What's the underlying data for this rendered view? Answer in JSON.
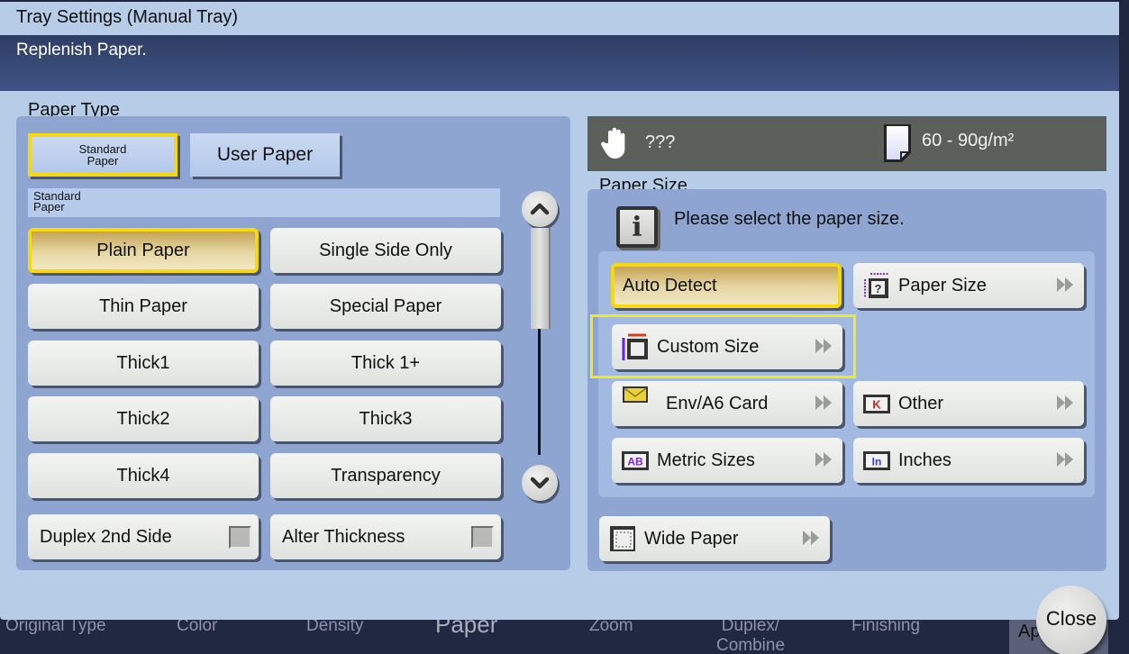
{
  "dialog": {
    "title": "Tray Settings (Manual Tray)",
    "message": "Replenish Paper."
  },
  "paper_type": {
    "label": "Paper Type",
    "tabs": [
      {
        "label": "Standard\nPaper",
        "selected": true
      },
      {
        "label": "User Paper",
        "selected": false
      }
    ],
    "category_label": "Standard\nPaper",
    "options": [
      {
        "label": "Plain Paper",
        "selected": true
      },
      {
        "label": "Single Side Only",
        "selected": false
      },
      {
        "label": "Thin Paper",
        "selected": false
      },
      {
        "label": "Special Paper",
        "selected": false
      },
      {
        "label": "Thick1",
        "selected": false
      },
      {
        "label": "Thick 1+",
        "selected": false
      },
      {
        "label": "Thick2",
        "selected": false
      },
      {
        "label": "Thick3",
        "selected": false
      },
      {
        "label": "Thick4",
        "selected": false
      },
      {
        "label": "Transparency",
        "selected": false
      }
    ],
    "toggles": [
      {
        "label": "Duplex 2nd Side",
        "checked": false
      },
      {
        "label": "Alter Thickness",
        "checked": false
      }
    ],
    "scroll": {
      "up_icon": "chevron-up-icon",
      "down_icon": "chevron-down-icon"
    }
  },
  "status": {
    "manual_icon": "hand-icon",
    "manual_value": "???",
    "weight_icon": "paper-sheet-icon",
    "weight_value": "60 - 90g/m²"
  },
  "paper_size": {
    "label": "Paper Size",
    "info_icon": "info-icon",
    "info_text": "Please select the paper size.",
    "options": [
      {
        "label": "Auto Detect",
        "selected": true,
        "icon": null,
        "has_arrow": false
      },
      {
        "label": "Paper Size",
        "selected": false,
        "icon": "paper-size-icon",
        "has_arrow": true
      },
      {
        "label": "Custom Size",
        "selected": false,
        "icon": "custom-size-icon",
        "has_arrow": true,
        "highlighted": true
      },
      {
        "label": "Env/A6 Card",
        "selected": false,
        "icon": "envelope-icon",
        "has_arrow": true
      },
      {
        "label": "Other",
        "selected": false,
        "icon": "other-size-icon",
        "has_arrow": true
      },
      {
        "label": "Metric Sizes",
        "selected": false,
        "icon": "metric-ab-icon",
        "has_arrow": true
      },
      {
        "label": "Inches",
        "selected": false,
        "icon": "inches-icon",
        "has_arrow": true
      }
    ],
    "wide_paper": {
      "label": "Wide Paper",
      "icon": "wide-paper-icon",
      "has_arrow": true
    }
  },
  "close_label": "Close",
  "bottom_nav": {
    "items": [
      "Original Type",
      "Color",
      "Density",
      "Paper",
      "Zoom",
      "Duplex/\nCombine",
      "Finishing"
    ],
    "active": "Paper",
    "apply_label": "Ap"
  },
  "colors": {
    "selected_border": "#f6d80c",
    "highlight_box": "#f2ea20",
    "message_bar": "#34446e",
    "panel": "#8ea4d1",
    "dialog_bg": "#b7cce7",
    "status_bar": "#5c605b"
  }
}
